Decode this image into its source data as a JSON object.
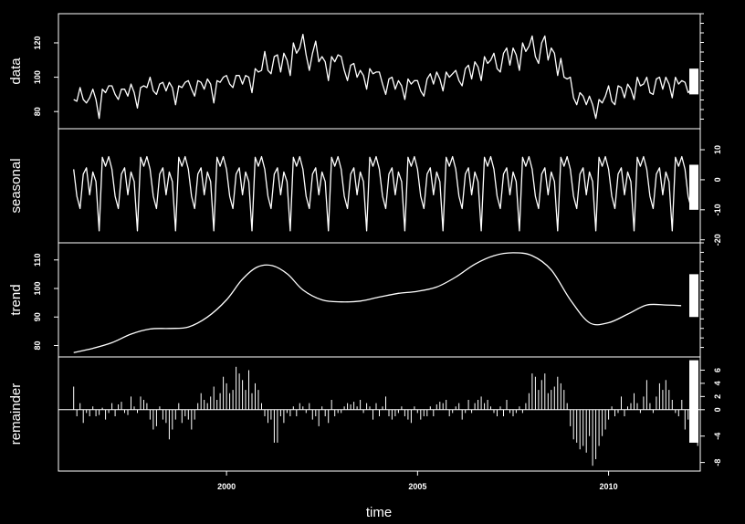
{
  "chart_data": {
    "type": "stl-decomposition",
    "xlabel": "time",
    "xlim": [
      1995.6,
      2012.4
    ],
    "x_ticks": [
      {
        "value": 2000,
        "label": "2000"
      },
      {
        "value": 2005,
        "label": "2005"
      },
      {
        "value": 2010,
        "label": "2010"
      }
    ],
    "start": 1996.0,
    "frequency": 12,
    "panels": [
      {
        "name": "data",
        "label": "data",
        "ylim": [
          70,
          137
        ],
        "tick_side": "left",
        "yticks": [
          {
            "value": 80,
            "label": "80"
          },
          {
            "value": 100,
            "label": "100"
          },
          {
            "value": 120,
            "label": "120"
          }
        ],
        "minor_right": true,
        "range_bar": [
          90,
          105
        ],
        "style": "line",
        "values": [
          87,
          86,
          94,
          87,
          85,
          88,
          93,
          87,
          76,
          93,
          91,
          95,
          95,
          90,
          87,
          93,
          93,
          89,
          96,
          91,
          82,
          94,
          95,
          94,
          100,
          92,
          90,
          96,
          97,
          92,
          97,
          94,
          84,
          95,
          94,
          97,
          98,
          93,
          89,
          98,
          97,
          93,
          99,
          96,
          85,
          98,
          97,
          100,
          101,
          96,
          94,
          101,
          101,
          96,
          101,
          100,
          91,
          105,
          103,
          104,
          115,
          104,
          102,
          112,
          113,
          103,
          114,
          110,
          101,
          120,
          114,
          117,
          125,
          113,
          104,
          114,
          121,
          109,
          112,
          109,
          98,
          112,
          109,
          113,
          112,
          104,
          98,
          107,
          108,
          100,
          104,
          101,
          93,
          105,
          102,
          103,
          103,
          96,
          90,
          99,
          100,
          93,
          98,
          95,
          87,
          99,
          96,
          98,
          98,
          92,
          89,
          99,
          102,
          96,
          103,
          99,
          92,
          103,
          100,
          102,
          104,
          98,
          95,
          105,
          107,
          99,
          109,
          106,
          98,
          112,
          108,
          110,
          114,
          105,
          103,
          114,
          117,
          107,
          117,
          113,
          104,
          120,
          115,
          118,
          124,
          112,
          108,
          120,
          124,
          110,
          117,
          114,
          101,
          111,
          100,
          99,
          100,
          88,
          84,
          91,
          89,
          84,
          89,
          84,
          76,
          87,
          85,
          89,
          95,
          86,
          84,
          95,
          94,
          88,
          96,
          93,
          87,
          100,
          95,
          96,
          100,
          91,
          90,
          99,
          100,
          93,
          100,
          96,
          88,
          100,
          96,
          98,
          97,
          91,
          93,
          94,
          94
        ]
      },
      {
        "name": "seasonal",
        "label": "seasonal",
        "ylim": [
          -21,
          17
        ],
        "tick_side": "right",
        "yticks": [
          {
            "value": -20,
            "label": "-20"
          },
          {
            "value": -10,
            "label": "-10"
          },
          {
            "value": 0,
            "label": "0"
          },
          {
            "value": 10,
            "label": "10"
          }
        ],
        "range_bar": [
          -10,
          5
        ],
        "style": "line",
        "pattern": [
          3.5,
          -5.5,
          -9.6,
          1.9,
          4.0,
          -5.0,
          2.6,
          -0.6,
          -17.0,
          7.5,
          4.5,
          7.7
        ]
      },
      {
        "name": "trend",
        "label": "trend",
        "ylim": [
          76,
          116
        ],
        "tick_side": "left",
        "yticks": [
          {
            "value": 80,
            "label": "80"
          },
          {
            "value": 90,
            "label": "90"
          },
          {
            "value": 100,
            "label": "100"
          },
          {
            "value": 110,
            "label": "110"
          }
        ],
        "minor_right": true,
        "range_bar": [
          90,
          105
        ],
        "style": "line",
        "knots": [
          [
            1996.0,
            77.5
          ],
          [
            1996.5,
            79
          ],
          [
            1997.0,
            81
          ],
          [
            1997.5,
            84
          ],
          [
            1998.0,
            85.8
          ],
          [
            1998.5,
            86
          ],
          [
            1999.0,
            86.5
          ],
          [
            1999.5,
            90
          ],
          [
            2000.0,
            96
          ],
          [
            2000.4,
            103
          ],
          [
            2000.8,
            107.5
          ],
          [
            2001.2,
            108
          ],
          [
            2001.6,
            105
          ],
          [
            2002.0,
            99.5
          ],
          [
            2002.5,
            96
          ],
          [
            2003.0,
            95.3
          ],
          [
            2003.5,
            95.6
          ],
          [
            2004.0,
            97
          ],
          [
            2004.5,
            98.3
          ],
          [
            2005.0,
            99
          ],
          [
            2005.5,
            100.5
          ],
          [
            2006.0,
            104
          ],
          [
            2006.5,
            108.5
          ],
          [
            2007.0,
            111.5
          ],
          [
            2007.5,
            112.5
          ],
          [
            2008.0,
            111.5
          ],
          [
            2008.5,
            106.5
          ],
          [
            2009.0,
            96
          ],
          [
            2009.5,
            88
          ],
          [
            2010.0,
            88
          ],
          [
            2010.5,
            91
          ],
          [
            2011.0,
            94.2
          ],
          [
            2011.5,
            94.2
          ],
          [
            2011.9,
            94
          ]
        ]
      },
      {
        "name": "remainder",
        "label": "remainder",
        "ylim": [
          -9.3,
          8.0
        ],
        "tick_side": "right",
        "yticks": [
          {
            "value": -8,
            "label": "-8"
          },
          {
            "value": -4,
            "label": "-4"
          },
          {
            "value": 0,
            "label": "0"
          },
          {
            "value": 2,
            "label": "2"
          },
          {
            "value": 4,
            "label": "4"
          },
          {
            "value": 6,
            "label": "6"
          }
        ],
        "range_bar": [
          -5,
          7.5
        ],
        "style": "bars",
        "zero_line": true,
        "values": [
          3.5,
          -1.0,
          1.0,
          -2.0,
          -0.5,
          -1.0,
          0.5,
          -1.0,
          -0.8,
          0.3,
          -1.5,
          -0.5,
          1.0,
          -1.0,
          0.8,
          1.2,
          -0.5,
          -0.8,
          2.0,
          0.5,
          -0.5,
          2.0,
          1.5,
          1.0,
          -1.5,
          -3.0,
          -2.5,
          0.5,
          -1.5,
          -2.0,
          -4.5,
          -3.0,
          -1.5,
          1.0,
          -2.0,
          -1.0,
          -1.5,
          -3.0,
          -1.5,
          1.0,
          2.5,
          1.5,
          1.0,
          2.0,
          3.5,
          1.5,
          2.5,
          5.0,
          4.0,
          2.5,
          3.0,
          6.5,
          5.5,
          4.5,
          3.0,
          6.0,
          2.5,
          4.0,
          3.0,
          1.0,
          -1.0,
          -2.0,
          -1.5,
          -5.0,
          -5.0,
          -1.0,
          -2.0,
          -0.5,
          -1.0,
          0.5,
          -1.0,
          1.0,
          0.5,
          -0.5,
          1.0,
          -1.5,
          -1.0,
          -2.5,
          0.5,
          -1.0,
          -2.0,
          1.5,
          -1.0,
          -0.5,
          -0.5,
          0.5,
          1.0,
          0.8,
          1.2,
          0.5,
          1.5,
          -0.5,
          1.0,
          0.5,
          -1.5,
          1.0,
          -1.0,
          0.5,
          2.0,
          -1.0,
          -1.5,
          -1.0,
          -0.5,
          0.5,
          -1.0,
          -1.5,
          -2.0,
          0.5,
          -0.5,
          -1.5,
          -1.0,
          -1.0,
          0.5,
          -1.0,
          0.8,
          1.2,
          1.0,
          1.5,
          -1.0,
          -0.5,
          0.5,
          1.0,
          -1.5,
          -0.5,
          1.5,
          -0.5,
          1.0,
          1.5,
          2.0,
          1.0,
          1.5,
          0.5,
          -0.5,
          -1.0,
          0.5,
          -1.0,
          1.5,
          -0.5,
          -1.0,
          -0.5,
          0.5,
          -0.5,
          1.0,
          2.5,
          5.5,
          5.0,
          3.0,
          4.5,
          5.5,
          2.5,
          3.0,
          3.5,
          5.0,
          4.0,
          3.0,
          1.0,
          -2.5,
          -4.5,
          -5.0,
          -6.0,
          -5.5,
          -6.5,
          -4.0,
          -8.5,
          -7.5,
          -5.5,
          -4.0,
          -3.0,
          -1.5,
          0.5,
          -1.0,
          -0.5,
          2.0,
          -1.0,
          0.5,
          1.0,
          2.5,
          1.0,
          -0.5,
          2.0,
          4.5,
          1.0,
          -0.5,
          2.0,
          4.0,
          3.0,
          4.5,
          3.0,
          1.5,
          -0.5,
          -1.0,
          1.5,
          -3.0,
          -1.5,
          -0.5,
          -3.0,
          -5.5
        ]
      }
    ]
  }
}
